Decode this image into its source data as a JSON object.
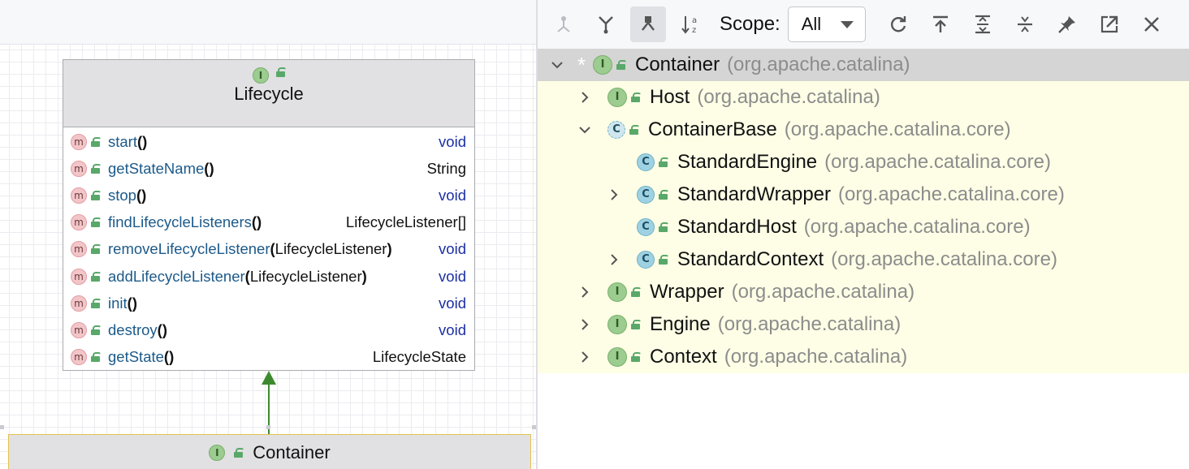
{
  "diagram": {
    "lifecycle": {
      "title": "Lifecycle",
      "methods": [
        {
          "name": "start",
          "params": "",
          "return": "void"
        },
        {
          "name": "getStateName",
          "params": "",
          "return": "String"
        },
        {
          "name": "stop",
          "params": "",
          "return": "void"
        },
        {
          "name": "findLifecycleListeners",
          "params": "",
          "return": "LifecycleListener[]"
        },
        {
          "name": "removeLifecycleListener",
          "params": "LifecycleListener",
          "return": "void"
        },
        {
          "name": "addLifecycleListener",
          "params": "LifecycleListener",
          "return": "void"
        },
        {
          "name": "init",
          "params": "",
          "return": "void"
        },
        {
          "name": "destroy",
          "params": "",
          "return": "void"
        },
        {
          "name": "getState",
          "params": "",
          "return": "LifecycleState"
        }
      ]
    },
    "container": {
      "title": "Container"
    },
    "icons": {
      "interface": "I",
      "method": "m",
      "class": "C"
    }
  },
  "hierarchy": {
    "scope_label": "Scope:",
    "scope_value": "All",
    "toolbar_icons": [
      "subtypes-icon",
      "supertypes-icon",
      "type-hierarchy-icon",
      "sort-alpha-icon",
      "refresh-icon",
      "base-on-class-icon",
      "expand-all-icon",
      "collapse-all-icon",
      "pin-icon",
      "export-icon",
      "close-icon"
    ],
    "root": {
      "name": "Container",
      "package": "(org.apache.catalina)",
      "marker": "*"
    },
    "items": [
      {
        "name": "Host",
        "package": "(org.apache.catalina)",
        "kind": "I",
        "chevron": "right"
      },
      {
        "name": "ContainerBase",
        "package": "(org.apache.catalina.core)",
        "kind": "C",
        "chevron": "down"
      },
      {
        "name": "StandardEngine",
        "package": "(org.apache.catalina.core)",
        "kind": "C",
        "chevron": "none"
      },
      {
        "name": "StandardWrapper",
        "package": "(org.apache.catalina.core)",
        "kind": "C",
        "chevron": "right"
      },
      {
        "name": "StandardHost",
        "package": "(org.apache.catalina.core)",
        "kind": "C",
        "chevron": "none"
      },
      {
        "name": "StandardContext",
        "package": "(org.apache.catalina.core)",
        "kind": "C",
        "chevron": "right"
      },
      {
        "name": "Wrapper",
        "package": "(org.apache.catalina)",
        "kind": "I",
        "chevron": "right"
      },
      {
        "name": "Engine",
        "package": "(org.apache.catalina)",
        "kind": "I",
        "chevron": "right"
      },
      {
        "name": "Context",
        "package": "(org.apache.catalina)",
        "kind": "I",
        "chevron": "right"
      }
    ]
  }
}
